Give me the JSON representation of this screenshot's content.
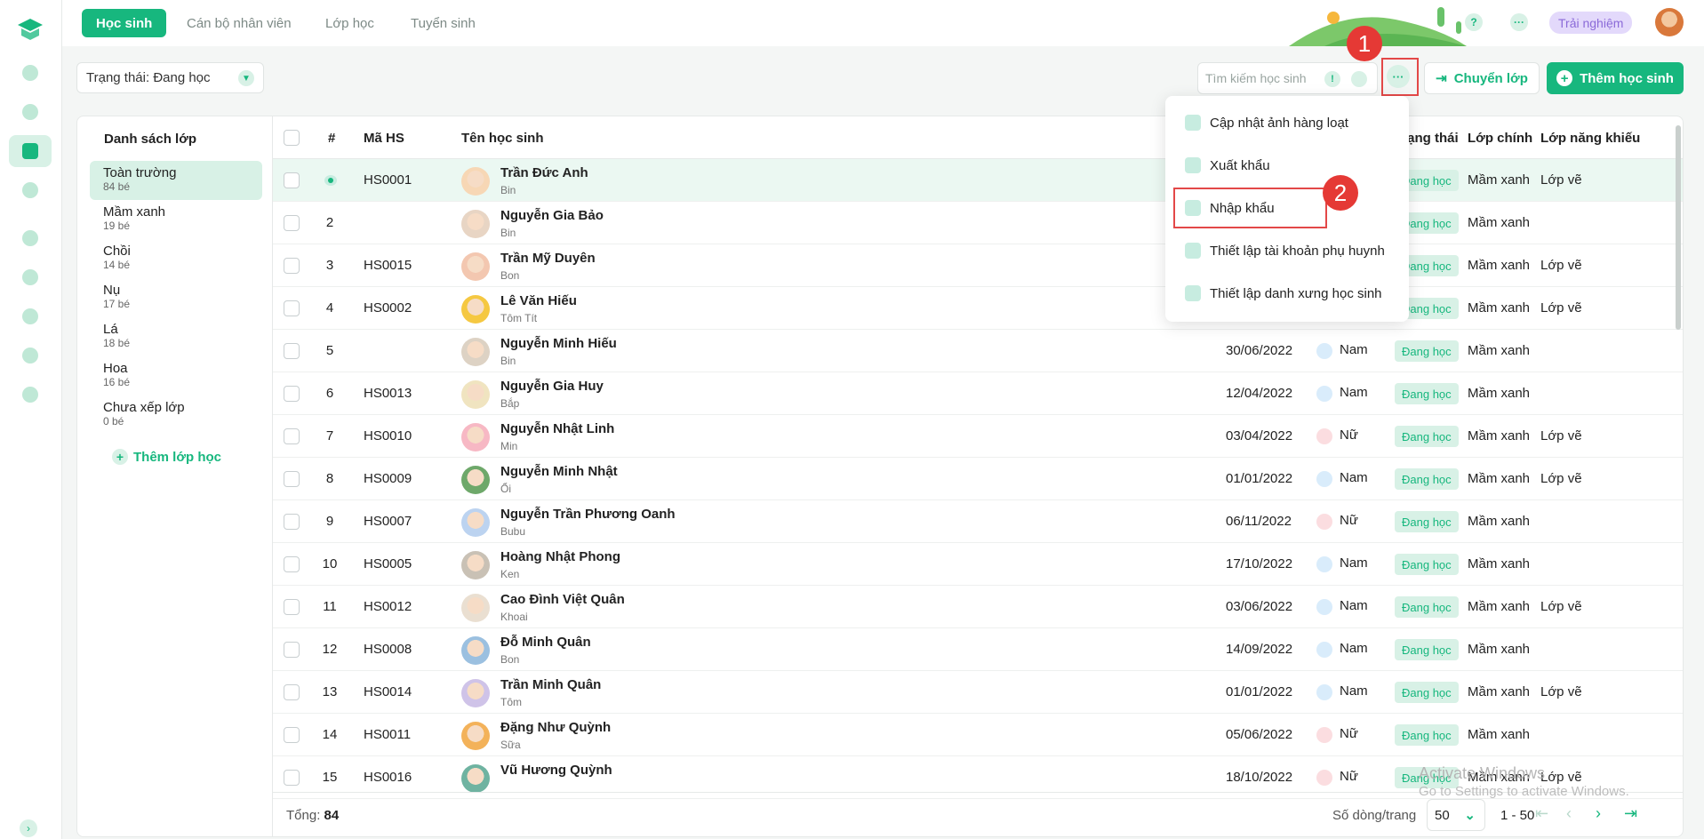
{
  "top_tabs": [
    "Học sinh",
    "Cán bộ nhân viên",
    "Lớp học",
    "Tuyển sinh"
  ],
  "top_right": {
    "help": "?",
    "more": "···",
    "trial": "Trải nghiệm"
  },
  "filter": {
    "label": "Trạng thái: Đang học"
  },
  "search": {
    "placeholder": "Tìm kiếm học sinh",
    "info": "!"
  },
  "toolbar": {
    "more": "···",
    "transfer_label": "Chuyển lớp",
    "add_label": "Thêm học sinh"
  },
  "callouts": {
    "one": "1",
    "two": "2"
  },
  "classlist": {
    "title": "Danh sách lớp",
    "items": [
      {
        "name": "Toàn trường",
        "count": "84 bé"
      },
      {
        "name": "Mầm xanh",
        "count": "19 bé"
      },
      {
        "name": "Chồi",
        "count": "14 bé"
      },
      {
        "name": "Nụ",
        "count": "17 bé"
      },
      {
        "name": "Lá",
        "count": "18 bé"
      },
      {
        "name": "Hoa",
        "count": "16 bé"
      },
      {
        "name": "Chưa xếp lớp",
        "count": "0 bé"
      }
    ],
    "add_label": "Thêm lớp học"
  },
  "table": {
    "headers": {
      "idx": "#",
      "code": "Mã HS",
      "name": "Tên học sinh",
      "status": "Trạng thái",
      "main_class": "Lớp chính",
      "talent_class": "Lớp năng khiếu"
    },
    "rows": [
      {
        "idx": "",
        "code": "HS0001",
        "name": "Trần Đức Anh",
        "nick": "Bin",
        "dob": "",
        "gender": "",
        "status": "Đang học",
        "main": "Mầm xanh",
        "talent": "Lớp vẽ"
      },
      {
        "idx": "2",
        "code": "",
        "name": "Nguyễn Gia Bảo",
        "nick": "Bin",
        "dob": "",
        "gender": "",
        "status": "Đang học",
        "main": "Mầm xanh",
        "talent": ""
      },
      {
        "idx": "3",
        "code": "HS0015",
        "name": "Trần Mỹ Duyên",
        "nick": "Bon",
        "dob": "",
        "gender": "",
        "status": "Đang học",
        "main": "Mầm xanh",
        "talent": "Lớp vẽ"
      },
      {
        "idx": "4",
        "code": "HS0002",
        "name": "Lê Văn Hiếu",
        "nick": "Tôm Tít",
        "dob": "",
        "gender": "",
        "status": "Đang học",
        "main": "Mầm xanh",
        "talent": "Lớp vẽ"
      },
      {
        "idx": "5",
        "code": "",
        "name": "Nguyễn Minh Hiếu",
        "nick": "Bin",
        "dob": "30/06/2022",
        "gender": "Nam",
        "status": "Đang học",
        "main": "Mầm xanh",
        "talent": ""
      },
      {
        "idx": "6",
        "code": "HS0013",
        "name": "Nguyễn Gia Huy",
        "nick": "Bắp",
        "dob": "12/04/2022",
        "gender": "Nam",
        "status": "Đang học",
        "main": "Mầm xanh",
        "talent": ""
      },
      {
        "idx": "7",
        "code": "HS0010",
        "name": "Nguyễn Nhật Linh",
        "nick": "Min",
        "dob": "03/04/2022",
        "gender": "Nữ",
        "status": "Đang học",
        "main": "Mầm xanh",
        "talent": "Lớp vẽ"
      },
      {
        "idx": "8",
        "code": "HS0009",
        "name": "Nguyễn Minh Nhật",
        "nick": "Ổi",
        "dob": "01/01/2022",
        "gender": "Nam",
        "status": "Đang học",
        "main": "Mầm xanh",
        "talent": "Lớp vẽ"
      },
      {
        "idx": "9",
        "code": "HS0007",
        "name": "Nguyễn Trần Phương Oanh",
        "nick": "Bubu",
        "dob": "06/11/2022",
        "gender": "Nữ",
        "status": "Đang học",
        "main": "Mầm xanh",
        "talent": ""
      },
      {
        "idx": "10",
        "code": "HS0005",
        "name": "Hoàng Nhật Phong",
        "nick": "Ken",
        "dob": "17/10/2022",
        "gender": "Nam",
        "status": "Đang học",
        "main": "Mầm xanh",
        "talent": ""
      },
      {
        "idx": "11",
        "code": "HS0012",
        "name": "Cao Đình Việt Quân",
        "nick": "Khoai",
        "dob": "03/06/2022",
        "gender": "Nam",
        "status": "Đang học",
        "main": "Mầm xanh",
        "talent": "Lớp vẽ"
      },
      {
        "idx": "12",
        "code": "HS0008",
        "name": "Đỗ Minh Quân",
        "nick": "Bon",
        "dob": "14/09/2022",
        "gender": "Nam",
        "status": "Đang học",
        "main": "Mầm xanh",
        "talent": ""
      },
      {
        "idx": "13",
        "code": "HS0014",
        "name": "Trần Minh Quân",
        "nick": "Tôm",
        "dob": "01/01/2022",
        "gender": "Nam",
        "status": "Đang học",
        "main": "Mầm xanh",
        "talent": "Lớp vẽ"
      },
      {
        "idx": "14",
        "code": "HS0011",
        "name": "Đặng Như Quỳnh",
        "nick": "Sữa",
        "dob": "05/06/2022",
        "gender": "Nữ",
        "status": "Đang học",
        "main": "Mầm xanh",
        "talent": ""
      },
      {
        "idx": "15",
        "code": "HS0016",
        "name": "Vũ Hương Quỳnh",
        "nick": "",
        "dob": "18/10/2022",
        "gender": "Nữ",
        "status": "Đang học",
        "main": "Mầm xanh",
        "talent": "Lớp vẽ"
      }
    ]
  },
  "footer": {
    "total_label": "Tổng:",
    "total_value": "84",
    "rpp_label": "Số dòng/trang",
    "rpp_value": "50",
    "range": "1 - 50"
  },
  "menu": {
    "items": [
      "Cập nhật ảnh hàng loạt",
      "Xuất khẩu",
      "Nhập khẩu",
      "Thiết lập tài khoản phụ huynh",
      "Thiết lập danh xưng học sinh"
    ]
  },
  "watermark": {
    "line1": "Activate Windows",
    "line2": "Go to Settings to activate Windows."
  },
  "colors": {
    "accent": "#17b77e",
    "callout": "#e53935"
  }
}
